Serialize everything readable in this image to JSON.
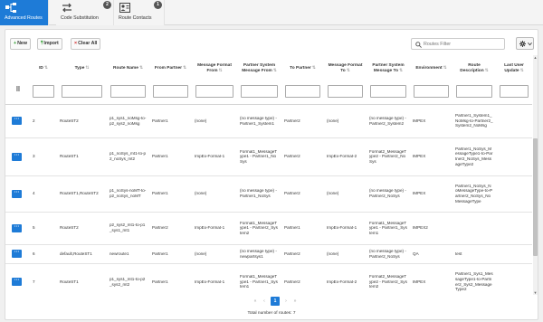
{
  "tabs": [
    {
      "label": "Advanced Routes",
      "icon": "routes-icon",
      "badge": ""
    },
    {
      "label": "Code Substitution",
      "icon": "swap-arrows-icon",
      "badge": "2"
    },
    {
      "label": "Route Contacts",
      "icon": "contact-card-icon",
      "badge": "1"
    }
  ],
  "toolbar": {
    "new_label": "New",
    "import_label": "Import",
    "clear_all_label": "Clear All",
    "search_placeholder": "Routes Filter"
  },
  "columns": [
    {
      "label": "",
      "sortable": false
    },
    {
      "label": "ID",
      "sortable": true
    },
    {
      "label": "Type",
      "sortable": true
    },
    {
      "label": "Route Name",
      "sortable": true
    },
    {
      "label": "From Partner",
      "sortable": true
    },
    {
      "label": "Message Format From",
      "sortable": true
    },
    {
      "label": "Partner System Message From",
      "sortable": true
    },
    {
      "label": "To Partner",
      "sortable": true
    },
    {
      "label": "Message Format To",
      "sortable": true
    },
    {
      "label": "Partner System Message To",
      "sortable": true
    },
    {
      "label": "Environment",
      "sortable": true
    },
    {
      "label": "Route Description",
      "sortable": true
    },
    {
      "label": "Last User Update",
      "sortable": true
    }
  ],
  "rows": [
    {
      "id": "2",
      "type": "RouteST2",
      "route_name": "p1_sys1_noMsg-to-p2_sys2_noMsg",
      "from_partner": "Partner1",
      "fmt_from": "(none)",
      "psm_from": "(no message type) - Partner1_System1",
      "to_partner": "Partner2",
      "fmt_to": "(none)",
      "psm_to": "(no message type) - Partner2_System2",
      "environment": "IMPEX",
      "description": "Partner1_System1_NoMsg-to-Partner2_System2_NoMsg",
      "last_user": ""
    },
    {
      "id": "3",
      "type": "RouteST1",
      "route_name": "p1_noSys_mt1-to-p2_noSys_mt2",
      "from_partner": "Partner1",
      "fmt_from": "ImpEx-Format-1",
      "psm_from": "Format1_MessageType1 - Partner1_NoSys",
      "to_partner": "Partner2",
      "fmt_to": "ImpEx-Format-2",
      "psm_to": "Format2_MessageType2 - Partner2_NoSys",
      "environment": "IMPEX",
      "description": "Partner1_NoSys_MessageType1-to-Partner2_NoSys_MessageType2",
      "last_user": ""
    },
    {
      "id": "4",
      "type": "RouteST1,RouteST2",
      "route_name": "p1_noSys-noMT-to-p2_noSys_noMT",
      "from_partner": "Partner1",
      "fmt_from": "(none)",
      "psm_from": "(no message type) - Partner1_NoSys",
      "to_partner": "Partner2",
      "fmt_to": "(none)",
      "psm_to": "(no message type) - Partner2_NoSys",
      "environment": "IMPEX",
      "description": "Partner1_NoSys_NoMessageType-to-Partner2_NoSys_NoMessageType",
      "last_user": ""
    },
    {
      "id": "5",
      "type": "RouteST2",
      "route_name": "p2_sys2_mt1-to-p1_sys1_mt1",
      "from_partner": "Partner2",
      "fmt_from": "ImpEx-Format-1",
      "psm_from": "Format1_MessageType1 - Partner2_System2",
      "to_partner": "Partner1",
      "fmt_to": "ImpEx-Format-1",
      "psm_to": "Format1_MessageType1 - Partner1_System1",
      "environment": "IMPEX2",
      "description": "",
      "last_user": ""
    },
    {
      "id": "6",
      "type": "default,RouteST1",
      "route_name": "newroute1",
      "from_partner": "Partner1",
      "fmt_from": "(none)",
      "psm_from": "(no message type) - newpartsys1",
      "to_partner": "Partner2",
      "fmt_to": "(none)",
      "psm_to": "(no message type) - Partner2_NoSys",
      "environment": "QA",
      "description": "test",
      "last_user": ""
    },
    {
      "id": "7",
      "type": "RouteST1",
      "route_name": "p1_sys1_mt1-to-p2_sys2_mt2",
      "from_partner": "Partner1",
      "fmt_from": "ImpEx-Format-1",
      "psm_from": "Format1_MessageType1 - Partner1_System1",
      "to_partner": "Partner2",
      "fmt_to": "ImpEx-Format-2",
      "psm_to": "Format2_MessageType2 - Partner2_System2",
      "environment": "IMPEX",
      "description": "Partner1_Sys1_MessageType1-to-Partner2_Sys2_MessageType2",
      "last_user": ""
    }
  ],
  "pager": {
    "first": "«",
    "prev": "‹",
    "current": "1",
    "next": "›",
    "last": "»"
  },
  "total_text": "Total number of routes: 7",
  "colors": {
    "accent": "#1e7bd7"
  }
}
